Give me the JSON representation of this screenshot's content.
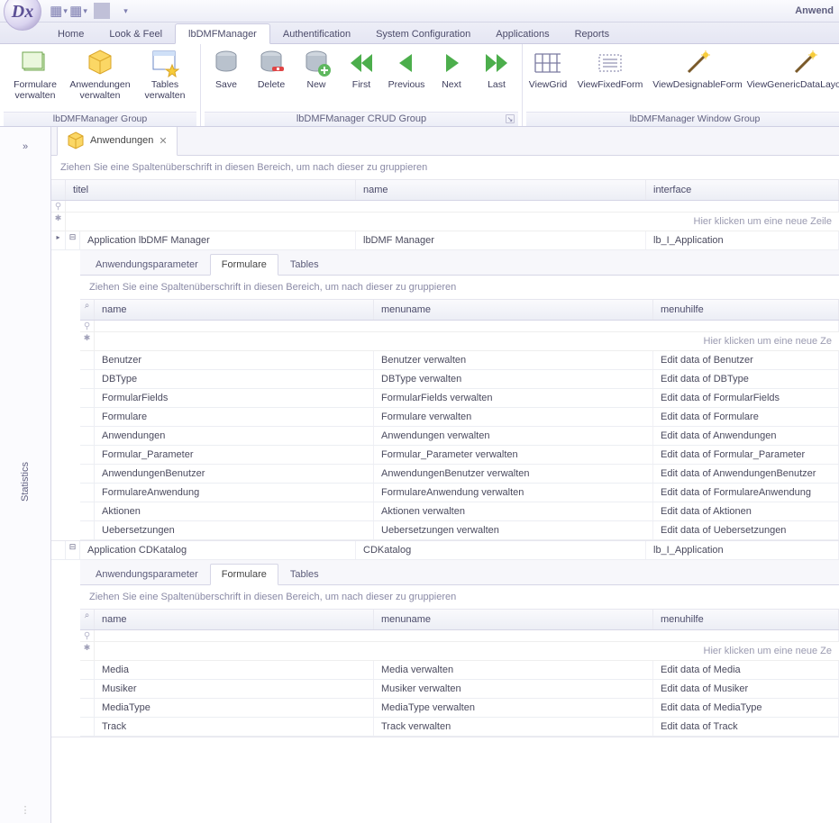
{
  "window_title": "Anwend",
  "ribbon_tabs": [
    "Home",
    "Look & Feel",
    "lbDMFManager",
    "Authentification",
    "System Configuration",
    "Applications",
    "Reports"
  ],
  "ribbon_active_index": 2,
  "group1": {
    "caption": "lbDMFManager Group",
    "items": [
      "Formulare verwalten",
      "Anwendungen verwalten",
      "Tables verwalten"
    ]
  },
  "group2": {
    "caption": "lbDMFManager CRUD Group",
    "items": [
      "Save",
      "Delete",
      "New",
      "First",
      "Previous",
      "Next",
      "Last"
    ]
  },
  "group3": {
    "caption": "lbDMFManager Window Group",
    "items": [
      "ViewGrid",
      "ViewFixedForm",
      "ViewDesignableForm",
      "ViewGenericDataLayoutFor"
    ]
  },
  "doctab": "Anwendungen",
  "grid": {
    "group_hint": "Ziehen Sie eine Spaltenüberschrift in diesen Bereich, um nach dieser zu gruppieren",
    "cols": [
      "titel",
      "name",
      "interface"
    ],
    "new_hint": "Hier klicken um eine neue Zeile",
    "rows": [
      {
        "titel": "Application lbDMF Manager",
        "name": "lbDMF Manager",
        "interface": "lb_I_Application"
      },
      {
        "titel": "Application CDKatalog",
        "name": "CDKatalog",
        "interface": "lb_I_Application"
      }
    ],
    "sub_tabs": [
      "Anwendungsparameter",
      "Formulare",
      "Tables"
    ],
    "sub_tab_active": 1,
    "sub_cols": [
      "name",
      "menuname",
      "menuhilfe"
    ],
    "sub_new_hint": "Hier klicken um eine neue Ze",
    "sub1_rows": [
      {
        "name": "Benutzer",
        "menuname": "Benutzer verwalten",
        "menuhilfe": "Edit data of Benutzer"
      },
      {
        "name": "DBType",
        "menuname": "DBType verwalten",
        "menuhilfe": "Edit data of DBType"
      },
      {
        "name": "FormularFields",
        "menuname": "FormularFields verwalten",
        "menuhilfe": "Edit data of FormularFields"
      },
      {
        "name": "Formulare",
        "menuname": "Formulare verwalten",
        "menuhilfe": "Edit data of Formulare"
      },
      {
        "name": "Anwendungen",
        "menuname": "Anwendungen verwalten",
        "menuhilfe": "Edit data of Anwendungen"
      },
      {
        "name": "Formular_Parameter",
        "menuname": "Formular_Parameter verwalten",
        "menuhilfe": "Edit data of Formular_Parameter"
      },
      {
        "name": "AnwendungenBenutzer",
        "menuname": "AnwendungenBenutzer verwalten",
        "menuhilfe": "Edit data of AnwendungenBenutzer"
      },
      {
        "name": "FormulareAnwendung",
        "menuname": "FormulareAnwendung verwalten",
        "menuhilfe": "Edit data of FormulareAnwendung"
      },
      {
        "name": "Aktionen",
        "menuname": "Aktionen verwalten",
        "menuhilfe": "Edit data of Aktionen"
      },
      {
        "name": "Uebersetzungen",
        "menuname": "Uebersetzungen verwalten",
        "menuhilfe": "Edit data of Uebersetzungen"
      }
    ],
    "sub2_rows": [
      {
        "name": "Media",
        "menuname": "Media verwalten",
        "menuhilfe": "Edit data of Media"
      },
      {
        "name": "Musiker",
        "menuname": "Musiker verwalten",
        "menuhilfe": "Edit data of Musiker"
      },
      {
        "name": "MediaType",
        "menuname": "MediaType verwalten",
        "menuhilfe": "Edit data of MediaType"
      },
      {
        "name": "Track",
        "menuname": "Track verwalten",
        "menuhilfe": "Edit data of Track"
      }
    ]
  },
  "side_label": "Statistics"
}
